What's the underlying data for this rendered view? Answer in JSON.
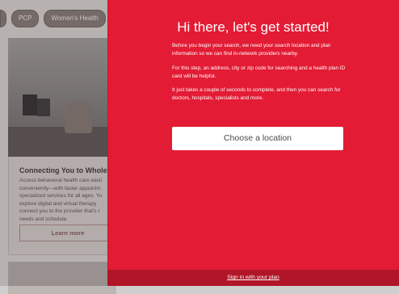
{
  "background": {
    "chips": [
      "PCP",
      "Women's Health"
    ],
    "card": {
      "title": "Connecting You to Whole-P",
      "body": "Access behavioral health care easil conveniently—with faster appointm specialized services for all ages. Yo explore digital and virtual therapy connect you to the provider that's r needs and schedule.",
      "button": "Learn more"
    }
  },
  "modal": {
    "title": "Hi there, let's get started!",
    "paragraphs": [
      "Before you begin your search, we need your search location and plan information so we can find in-network providers nearby.",
      "For this step, an address, city or zip code for searching and a health plan ID card will be helpful.",
      "It just takes a couple of seconds to complete, and then you can search for doctors, hospitals, specialists and more."
    ],
    "choose_button": "Choose a location",
    "footer_link": "Sign in with your plan"
  },
  "colors": {
    "modal_red": "#e31b34",
    "footer_red": "#b11528"
  }
}
